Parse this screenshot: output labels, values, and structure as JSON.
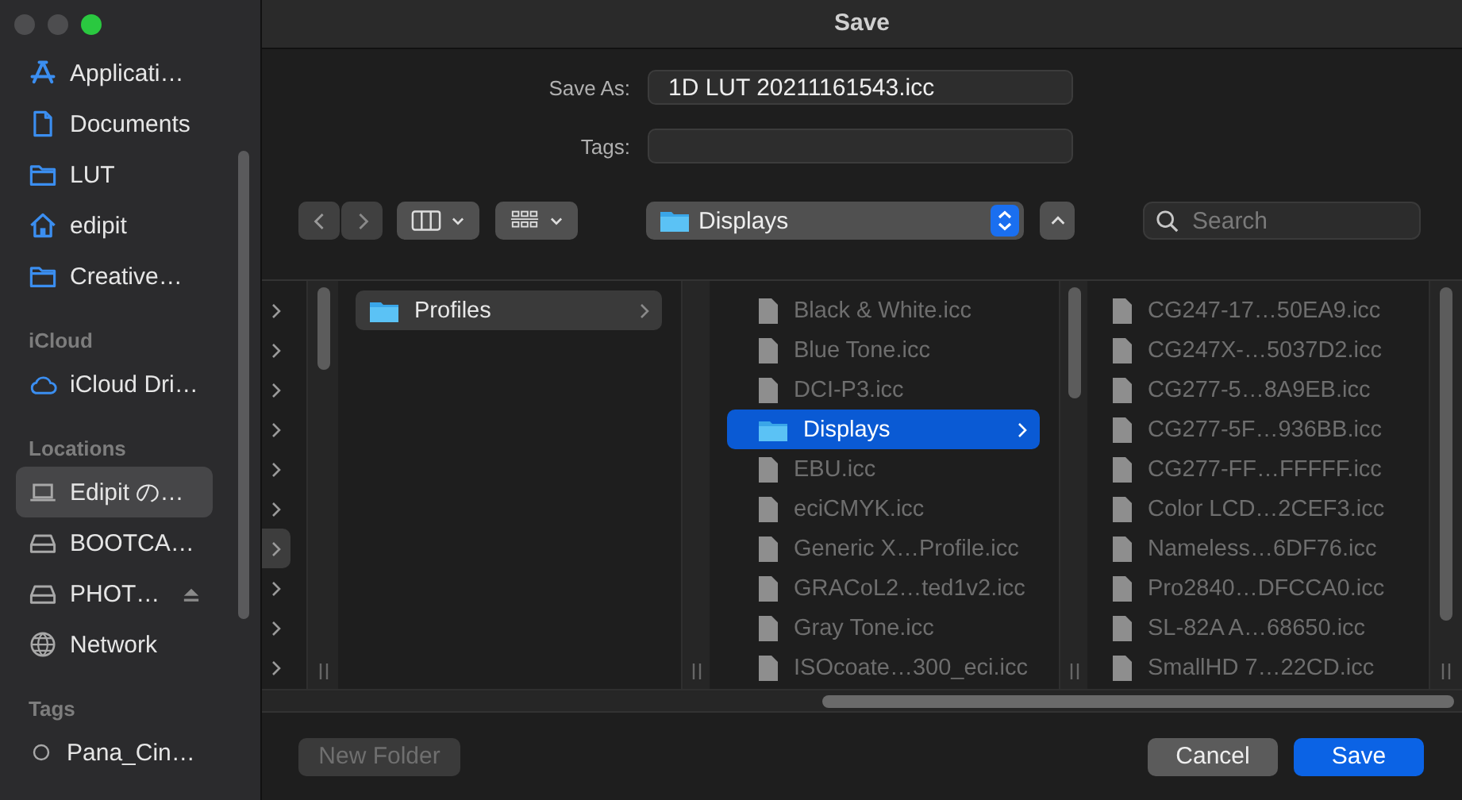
{
  "window": {
    "title": "Save"
  },
  "sidebar": {
    "sections": [
      {
        "items": [
          {
            "label": "Applicati…",
            "kind": "apps",
            "selected": false
          },
          {
            "label": "Documents",
            "kind": "document",
            "selected": false
          },
          {
            "label": "LUT",
            "kind": "folder",
            "selected": false
          },
          {
            "label": "edipit",
            "kind": "home",
            "selected": false
          },
          {
            "label": "Creative…",
            "kind": "folder",
            "selected": false
          }
        ]
      },
      {
        "header": "iCloud",
        "items": [
          {
            "label": "iCloud Dri…",
            "kind": "cloud",
            "selected": false
          }
        ]
      },
      {
        "header": "Locations",
        "items": [
          {
            "label": "Edipit の…",
            "kind": "laptop",
            "selected": true
          },
          {
            "label": "BOOTCA…",
            "kind": "drive",
            "selected": false
          },
          {
            "label": "PHOT…",
            "kind": "drive",
            "selected": false,
            "ejectable": true
          },
          {
            "label": "Network",
            "kind": "network",
            "selected": false
          }
        ]
      },
      {
        "header": "Tags",
        "items": [
          {
            "label": "Pana_Cin…",
            "kind": "tag",
            "selected": false
          }
        ]
      }
    ]
  },
  "form": {
    "save_as": {
      "label": "Save As:",
      "value": "1D LUT 20211161543.icc"
    },
    "tags": {
      "label": "Tags:"
    }
  },
  "toolbar": {
    "path_popup": {
      "label": "Displays"
    },
    "search": {
      "placeholder": "Search"
    }
  },
  "browser": {
    "columns": [
      {
        "rows": [
          {
            "selected": false
          },
          {
            "selected": false
          },
          {
            "selected": false
          },
          {
            "selected": false
          },
          {
            "selected": false
          },
          {
            "selected": false
          },
          {
            "selected": true
          },
          {
            "selected": false
          },
          {
            "selected": false
          },
          {
            "selected": false
          }
        ]
      },
      {
        "rows": [
          {
            "name": "Profiles",
            "kind": "folder",
            "selected": true
          }
        ]
      },
      {
        "rows": [
          {
            "name": "Black & White.icc",
            "kind": "file",
            "selected": false
          },
          {
            "name": "Blue Tone.icc",
            "kind": "file",
            "selected": false
          },
          {
            "name": "DCI-P3.icc",
            "kind": "file",
            "selected": false
          },
          {
            "name": "Displays",
            "kind": "folder",
            "selected": true
          },
          {
            "name": "EBU.icc",
            "kind": "file",
            "selected": false
          },
          {
            "name": "eciCMYK.icc",
            "kind": "file",
            "selected": false
          },
          {
            "name": "Generic X…Profile.icc",
            "kind": "file",
            "selected": false
          },
          {
            "name": "GRACoL2…ted1v2.icc",
            "kind": "file",
            "selected": false
          },
          {
            "name": "Gray Tone.icc",
            "kind": "file",
            "selected": false
          },
          {
            "name": "ISOcoate…300_eci.icc",
            "kind": "file",
            "selected": false
          }
        ]
      },
      {
        "rows": [
          {
            "name": "CG247-17…50EA9.icc",
            "kind": "file",
            "selected": false
          },
          {
            "name": "CG247X-…5037D2.icc",
            "kind": "file",
            "selected": false
          },
          {
            "name": "CG277-5…8A9EB.icc",
            "kind": "file",
            "selected": false
          },
          {
            "name": "CG277-5F…936BB.icc",
            "kind": "file",
            "selected": false
          },
          {
            "name": "CG277-FF…FFFFF.icc",
            "kind": "file",
            "selected": false
          },
          {
            "name": "Color LCD…2CEF3.icc",
            "kind": "file",
            "selected": false
          },
          {
            "name": "Nameless…6DF76.icc",
            "kind": "file",
            "selected": false
          },
          {
            "name": "Pro2840…DFCCA0.icc",
            "kind": "file",
            "selected": false
          },
          {
            "name": "SL-82A A…68650.icc",
            "kind": "file",
            "selected": false
          },
          {
            "name": "SmallHD 7…22CD.icc",
            "kind": "file",
            "selected": false
          }
        ]
      }
    ]
  },
  "footer": {
    "buttons": [
      {
        "label": "New Folder",
        "kind": "secondary",
        "disabled": true
      },
      {
        "label": "Cancel",
        "kind": "secondary",
        "disabled": false
      },
      {
        "label": "Save",
        "kind": "primary",
        "disabled": false
      }
    ]
  }
}
